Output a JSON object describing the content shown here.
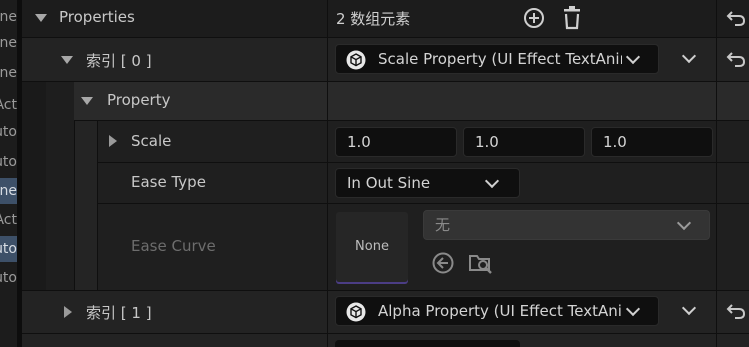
{
  "left_strip": {
    "items": [
      {
        "text": "ne",
        "selected": false
      },
      {
        "text": "ne",
        "selected": false
      },
      {
        "text": "ne",
        "selected": false
      },
      {
        "text": "Act",
        "selected": false
      },
      {
        "text": "uto",
        "selected": false
      },
      {
        "text": "uto",
        "selected": false
      },
      {
        "text": "ne",
        "selected": true
      },
      {
        "text": "Act",
        "selected": false
      },
      {
        "text": "uto",
        "selected": true
      },
      {
        "text": "uto",
        "selected": false
      }
    ]
  },
  "properties": {
    "label": "Properties",
    "count_text": "2 数组元素"
  },
  "index0": {
    "label": "索引 [ 0 ]",
    "value": "Scale Property (UI Effect TextAnim"
  },
  "property_group": {
    "label": "Property"
  },
  "scale": {
    "label": "Scale",
    "x": "1.0",
    "y": "1.0",
    "z": "1.0"
  },
  "ease_type": {
    "label": "Ease Type",
    "value": "In Out Sine"
  },
  "ease_curve": {
    "label": "Ease Curve",
    "thumb_text": "None",
    "asset_value": "无"
  },
  "index1": {
    "label": "索引 [ 1 ]",
    "value": "Alpha Property (UI Effect TextAnim"
  },
  "icons": {
    "add": "add-circle-icon",
    "delete": "trash-icon",
    "reset": "reset-arrow-icon",
    "chevron": "chevron-down-icon",
    "cube": "cube-icon",
    "use_selected": "arrow-left-circle-icon",
    "browse": "folder-search-icon"
  }
}
